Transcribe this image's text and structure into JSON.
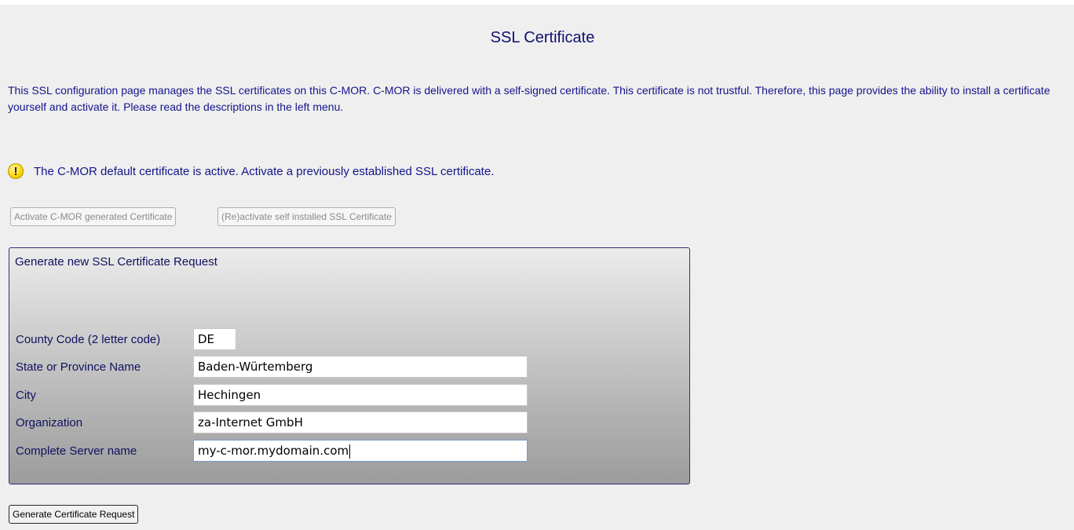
{
  "page": {
    "title": "SSL Certificate",
    "intro": "This SSL configuration page manages the SSL certificates on this C-MOR. C-MOR is delivered with a self-signed certificate. This certificate is not trustful. Therefore, this page provides the ability to install a certificate yourself and activate it. Please read the descriptions in the left menu.",
    "notice": {
      "icon": "warning-icon",
      "icon_glyph": "!",
      "text": "The C-MOR default certificate is active. Activate a previously established SSL certificate."
    }
  },
  "actions": {
    "activate_generated_label": "Activate C-MOR generated Certificate",
    "reactivate_self_installed_label": "(Re)activate self installed SSL Certificate"
  },
  "request_form": {
    "title": "Generate new SSL Certificate Request",
    "fields": {
      "country_code": {
        "label": "County Code (2 letter code)",
        "value": "DE"
      },
      "state": {
        "label": "State or Province Name",
        "value": "Baden-Würtemberg"
      },
      "city": {
        "label": "City",
        "value": "Hechingen"
      },
      "organization": {
        "label": "Organization",
        "value": "za-Internet GmbH"
      },
      "server_name": {
        "label": "Complete Server name",
        "value": "my-c-mor.mydomain.com"
      }
    },
    "submit_label": "Generate Certificate Request"
  },
  "colors": {
    "text": "#14148c",
    "page_background": "#efefef",
    "panel_border": "#30307a",
    "warning": "#ffd600"
  }
}
